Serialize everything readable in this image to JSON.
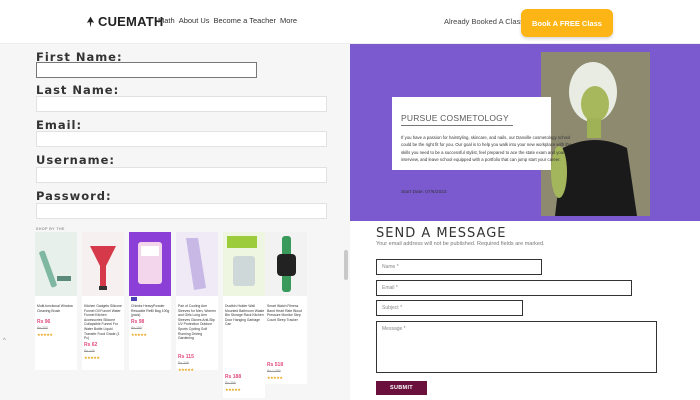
{
  "header": {
    "logo_text": "CUEMATH",
    "nav": [
      "Math",
      "About Us",
      "Become a Teacher",
      "More"
    ],
    "booked_text": "Already Booked A Class?",
    "cta_label": "Book A FREE Class",
    "accent": "#fdb515"
  },
  "form": {
    "first_name_label": "First Name:",
    "last_name_label": "Last Name:",
    "email_label": "Email:",
    "username_label": "Username:",
    "password_label": "Password:"
  },
  "products": {
    "strip_label": "SHOP BY THE",
    "items": [
      {
        "title": "Multi-functional Window Cleaning Brush",
        "price": "Rs 96",
        "mrp": "Rs 200",
        "stars": "★★★★★",
        "color": "#7fb8a0"
      },
      {
        "title": "Kitchen Gadgets Silicone Funnel Oil Funnel Water Funnel Kitchen Accessories Silicone Collapsible Funnel For Water Bottle Liquid Transfer Food Grade (1 Pc)",
        "price": "Rs 62",
        "mrp": "Rs 149",
        "stars": "★★★★★",
        "color": "#d63a4a"
      },
      {
        "title": "Chimbz HeavyPowder Resuable Refill Bag 100g (pack)",
        "price": "Rs 98",
        "mrp": "Rs 199",
        "stars": "★★★★★",
        "color": "#8b3fd6"
      },
      {
        "title": "Pair of Cooling Arm Sleeves for Men, Women and Girls Long Arm Sleeves Gloves Anti-Slip UV Protection Outdoor Sports Cycling Golf Running Driving Gardening",
        "price": "Rs 115",
        "mrp": "Rs 249",
        "stars": "★★★★★",
        "color": "#c8b8e6"
      },
      {
        "title": "Dustbin Holder Wall Mounted Bathroom Waste Bin Storage Rack Kitchen Door Hanging Garbage Can",
        "price": "Rs 188",
        "mrp": "Rs 399",
        "stars": "★★★★★",
        "color": "#9ccc3a"
      },
      {
        "title": "Smart Watch Fitness Band Heart Rate Blood Pressure Monitor Step Count Sleep Tracker",
        "price": "Rs 518",
        "mrp": "Rs 1,299",
        "stars": "★★★★★",
        "color": "#3a9a5c"
      }
    ]
  },
  "course": {
    "title": "PURSUE COSMETOLOGY",
    "description": "If you have a passion for hairstyling, skincare, and nails, our Danville cosmetology school could be the right fit for you. Our goal is to help you walk into your new workplace with the skills you need to be a successful stylist, feel prepared to ace the state exam and your interview, and leave school equipped with a portfolio that can jump start your career.",
    "start_date": "Start Date: 07/6/2023",
    "banner_color": "#7b5ad0"
  },
  "message": {
    "title": "SEND A MESSAGE",
    "note": "Your email address will not be published. Required fields are marked.",
    "name_placeholder": "Name *",
    "email_placeholder": "Email *",
    "subject_placeholder": "Subject *",
    "message_placeholder": "Message *",
    "submit_label": "SUBMIT",
    "submit_color": "#6b0f3c"
  }
}
